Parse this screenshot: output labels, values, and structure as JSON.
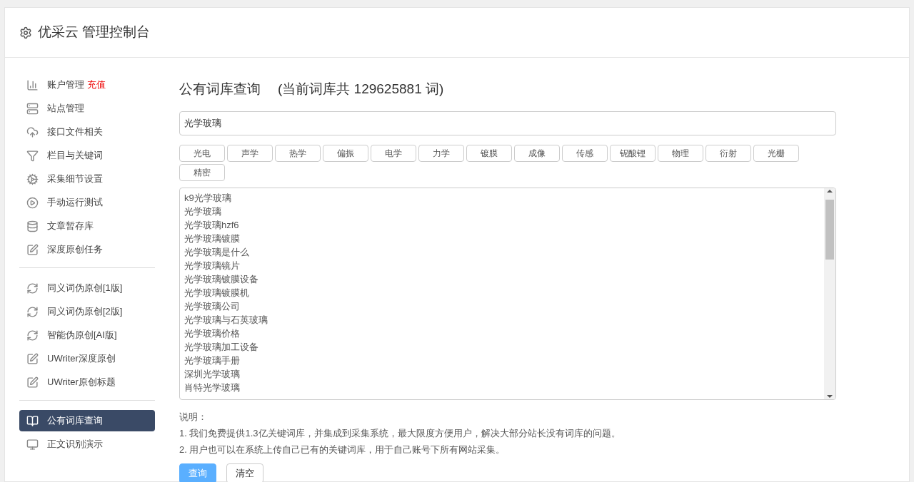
{
  "header": {
    "title": "优采云 管理控制台"
  },
  "sidebar": {
    "groups": [
      {
        "items": [
          {
            "kind": "chart",
            "label": "账户管理",
            "badge": "充值",
            "selected": false
          },
          {
            "kind": "server",
            "label": "站点管理",
            "selected": false
          },
          {
            "kind": "cloud",
            "label": "接口文件相关",
            "selected": false
          },
          {
            "kind": "filter",
            "label": "栏目与关键词",
            "selected": false
          },
          {
            "kind": "gears",
            "label": "采集细节设置",
            "selected": false
          },
          {
            "kind": "play",
            "label": "手动运行测试",
            "selected": false
          },
          {
            "kind": "database",
            "label": "文章暂存库",
            "selected": false
          },
          {
            "kind": "edit",
            "label": "深度原创任务",
            "selected": false
          }
        ]
      },
      {
        "items": [
          {
            "kind": "refresh",
            "label": "同义词伪原创[1版]",
            "selected": false
          },
          {
            "kind": "refresh",
            "label": "同义词伪原创[2版]",
            "selected": false
          },
          {
            "kind": "refresh",
            "label": "智能伪原创[AI版]",
            "selected": false
          },
          {
            "kind": "edit",
            "label": "UWriter深度原创",
            "selected": false
          },
          {
            "kind": "edit",
            "label": "UWriter原创标题",
            "selected": false
          }
        ]
      },
      {
        "items": [
          {
            "kind": "book",
            "label": "公有词库查询",
            "selected": true
          },
          {
            "kind": "monitor",
            "label": "正文识别演示",
            "selected": false
          }
        ]
      }
    ]
  },
  "main": {
    "title": "公有词库查询",
    "count_text": "(当前词库共 129625881 词)",
    "search": {
      "value": "光学玻璃"
    },
    "tags": [
      "光电",
      "声学",
      "热学",
      "偏振",
      "电学",
      "力学",
      "镀膜",
      "成像",
      "传感",
      "铌酸锂",
      "物理",
      "衍射",
      "光栅",
      "精密"
    ],
    "results": [
      "k9光学玻璃",
      "光学玻璃",
      "光学玻璃hzf6",
      "光学玻璃镀膜",
      "光学玻璃是什么",
      "光学玻璃镜片",
      "光学玻璃镀膜设备",
      "光学玻璃镀膜机",
      "光学玻璃公司",
      "光学玻璃与石英玻璃",
      "光学玻璃价格",
      "光学玻璃加工设备",
      "光学玻璃手册",
      "深圳光学玻璃",
      "肖特光学玻璃"
    ],
    "notes_title": "说明：",
    "notes": [
      "1. 我们免费提供1.3亿关键词库，并集成到采集系统，最大限度方便用户，解决大部分站长没有词库的问题。",
      "2. 用户也可以在系统上传自己已有的关键词库，用于自己账号下所有网站采集。"
    ],
    "buttons": [
      {
        "label": "查询",
        "kind": "primary"
      },
      {
        "label": "清空",
        "kind": "default"
      }
    ]
  }
}
